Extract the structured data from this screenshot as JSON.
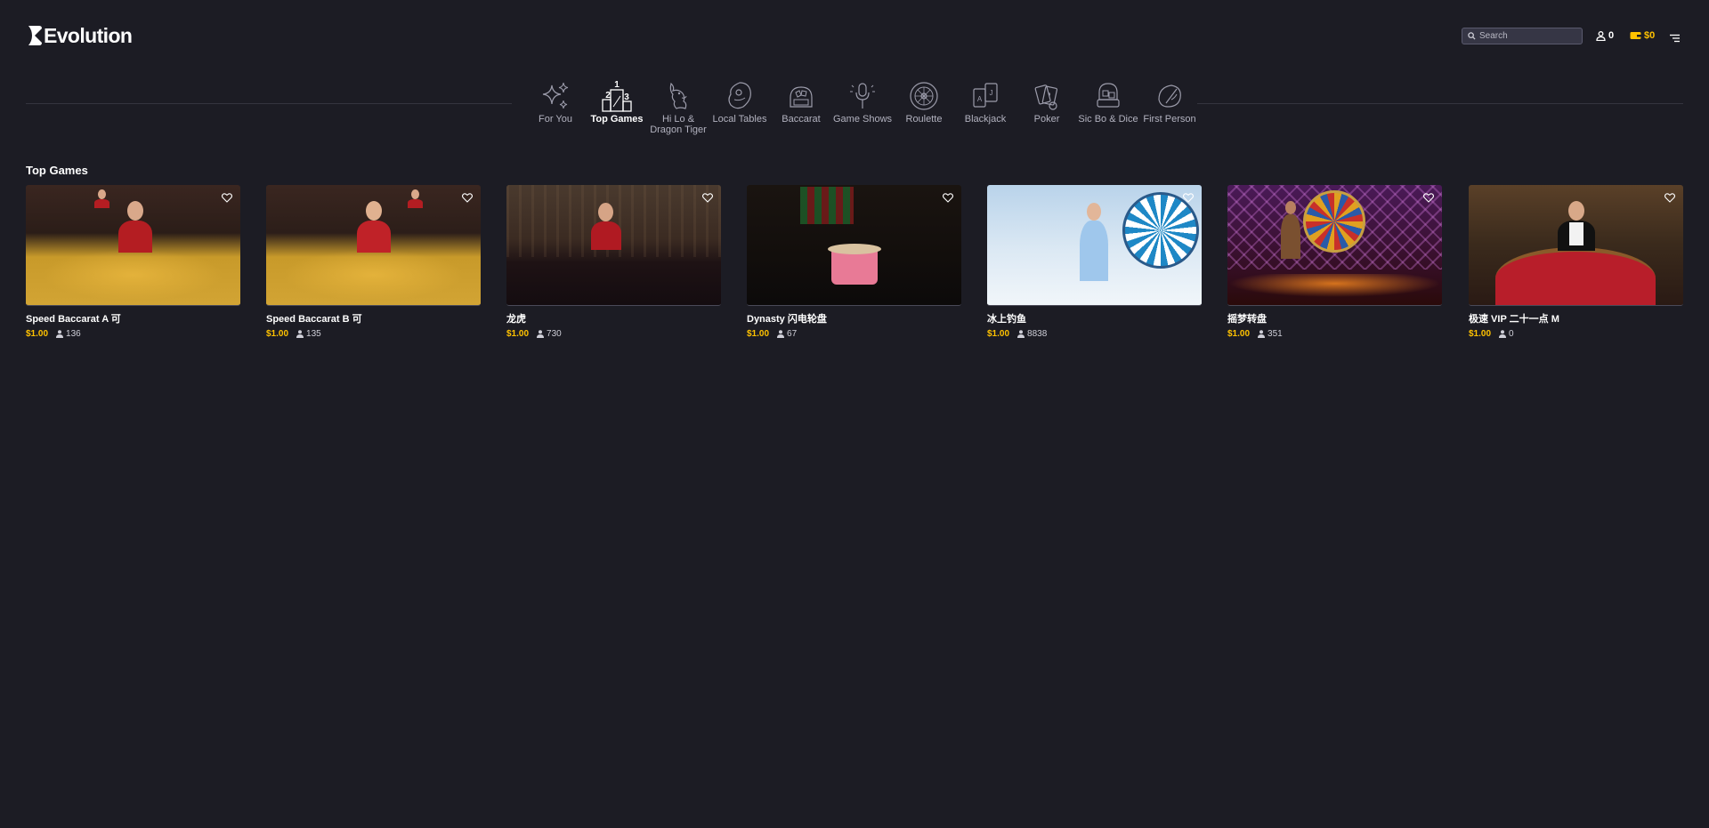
{
  "header": {
    "brand": "Evolution",
    "search_placeholder": "Search",
    "players_count": "0",
    "balance": "$0"
  },
  "nav": {
    "items": [
      {
        "label": "For You",
        "icon": "sparkles-icon",
        "active": false
      },
      {
        "label": "Top Games",
        "icon": "podium-icon",
        "active": true
      },
      {
        "label": "Hi Lo & Dragon Tiger",
        "icon": "dragon-icon",
        "active": false
      },
      {
        "label": "Local Tables",
        "icon": "globe-icon",
        "active": false
      },
      {
        "label": "Baccarat",
        "icon": "baccarat-icon",
        "active": false
      },
      {
        "label": "Game Shows",
        "icon": "microphone-icon",
        "active": false
      },
      {
        "label": "Roulette",
        "icon": "roulette-icon",
        "active": false
      },
      {
        "label": "Blackjack",
        "icon": "cards-icon",
        "active": false
      },
      {
        "label": "Poker",
        "icon": "poker-icon",
        "active": false
      },
      {
        "label": "Sic Bo & Dice",
        "icon": "dice-icon",
        "active": false
      },
      {
        "label": "First Person",
        "icon": "first-person-icon",
        "active": false
      }
    ]
  },
  "section": {
    "title": "Top Games"
  },
  "games": [
    {
      "title": "Speed Baccarat A 可",
      "price": "$1.00",
      "players": "136"
    },
    {
      "title": "Speed Baccarat B 可",
      "price": "$1.00",
      "players": "135"
    },
    {
      "title": "龙虎",
      "price": "$1.00",
      "players": "730"
    },
    {
      "title": "Dynasty 闪电轮盘",
      "price": "$1.00",
      "players": "67"
    },
    {
      "title": "冰上钓鱼",
      "price": "$1.00",
      "players": "8838"
    },
    {
      "title": "摇梦转盘",
      "price": "$1.00",
      "players": "351"
    },
    {
      "title": "极速 VIP 二十一点 M",
      "price": "$1.00",
      "players": "0"
    }
  ],
  "colors": {
    "background": "#1c1c24",
    "accent": "#ffc200",
    "text": "#ffffff",
    "muted": "#b2b2bf"
  }
}
